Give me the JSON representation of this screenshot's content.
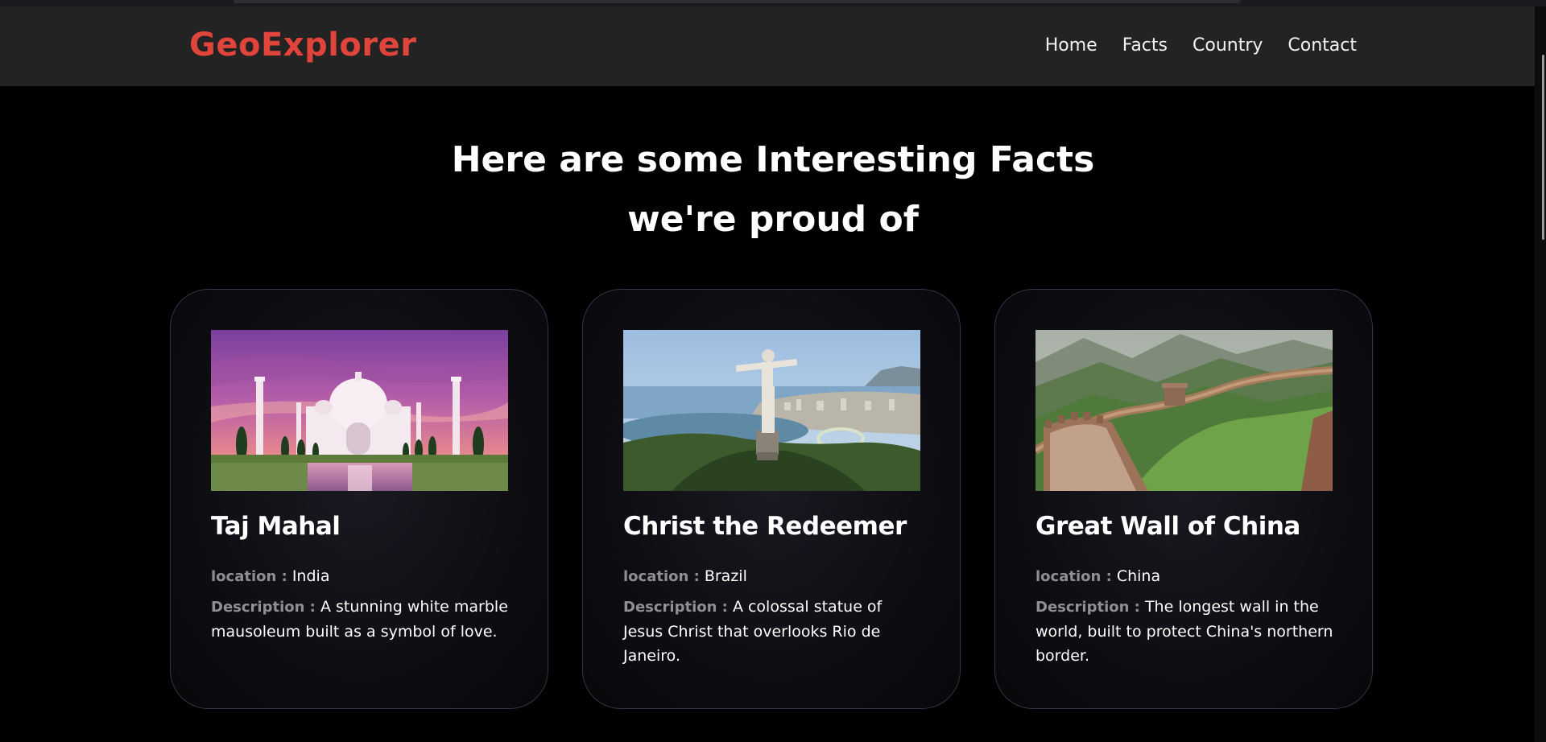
{
  "brand": {
    "name": "GeoExplorer",
    "color": "#e0443a"
  },
  "nav": {
    "items": [
      {
        "label": "Home"
      },
      {
        "label": "Facts"
      },
      {
        "label": "Country"
      },
      {
        "label": "Contact"
      }
    ]
  },
  "hero": {
    "line1": "Here are some Interesting Facts",
    "line2": "we're proud of"
  },
  "cards": [
    {
      "title": "Taj Mahal",
      "location_label": "location :",
      "location": "India",
      "description_label": "Description :",
      "description": "A stunning white marble mausoleum built as a symbol of love.",
      "image": "taj-mahal-photo"
    },
    {
      "title": "Christ the Redeemer",
      "location_label": "location :",
      "location": "Brazil",
      "description_label": "Description :",
      "description": "A colossal statue of Jesus Christ that overlooks Rio de Janeiro.",
      "image": "christ-the-redeemer-photo"
    },
    {
      "title": "Great Wall of China",
      "location_label": "location :",
      "location": "China",
      "description_label": "Description :",
      "description": "The longest wall in the world, built to protect China's northern border.",
      "image": "great-wall-photo"
    }
  ],
  "colors": {
    "background": "#000000",
    "navbar": "#232323",
    "label": "#8f8f94",
    "text": "#ffffff"
  }
}
